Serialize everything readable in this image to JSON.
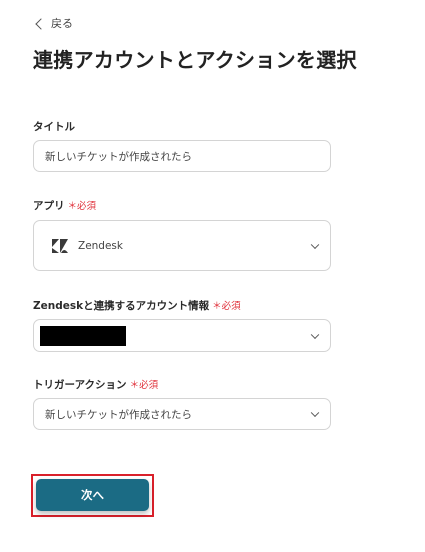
{
  "back": {
    "label": "戻る"
  },
  "page_title": "連携アカウントとアクションを選択",
  "form": {
    "title_field": {
      "label": "タイトル",
      "value": "新しいチケットが作成されたら"
    },
    "app_field": {
      "label": "アプリ",
      "required": "＊必須",
      "value": "Zendesk",
      "icon": "zendesk-logo"
    },
    "account_field": {
      "label": "Zendeskと連携するアカウント情報",
      "required": "＊必須"
    },
    "trigger_field": {
      "label": "トリガーアクション",
      "required": "＊必須",
      "value": "新しいチケットが作成されたら"
    }
  },
  "next_button": {
    "label": "次へ"
  },
  "colors": {
    "primary": "#1b6b84",
    "required": "#e0303a",
    "highlight": "#d9202a"
  }
}
